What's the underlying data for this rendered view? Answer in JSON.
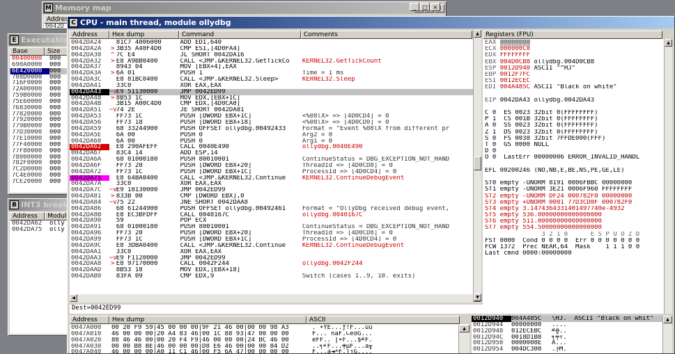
{
  "background_windows": {
    "memory_map": {
      "title": "Memory map",
      "icon": "M",
      "hdr": "Address",
      "row": "0042D"
    },
    "executable": {
      "title": "Executable modules",
      "icon": "E",
      "headers": [
        "Base",
        "Size"
      ],
      "rows": [
        {
          "base": "00400000",
          "size": "000",
          "red": true
        },
        {
          "base": "690A0000",
          "size": "000"
        },
        {
          "base": "6E420000",
          "size": "000",
          "sel": true
        },
        {
          "base": "708D0000",
          "size": "000"
        },
        {
          "base": "716F0000",
          "size": "000"
        },
        {
          "base": "72A00000",
          "size": "000"
        },
        {
          "base": "759B0000",
          "size": "000"
        },
        {
          "base": "75E60000",
          "size": "000"
        },
        {
          "base": "76830000",
          "size": "000"
        },
        {
          "base": "77820000",
          "size": "000"
        },
        {
          "base": "77920000",
          "size": "000"
        },
        {
          "base": "779B0000",
          "size": "000"
        },
        {
          "base": "77D30000",
          "size": "000"
        },
        {
          "base": "77E10000",
          "size": "000"
        },
        {
          "base": "77F40000",
          "size": "000"
        },
        {
          "base": "77F80000",
          "size": "000"
        },
        {
          "base": "78000000",
          "size": "000"
        },
        {
          "base": "782F0000",
          "size": "000"
        },
        {
          "base": "7C2D0000",
          "size": "000"
        },
        {
          "base": "7C4E0000",
          "size": "000"
        },
        {
          "base": "7CE20000",
          "size": "000"
        }
      ]
    },
    "int3": {
      "title": "INT3 breakpoints",
      "icon": "B",
      "headers": [
        "Address",
        "Module"
      ],
      "rows": [
        {
          "addr": "0042DA62",
          "mod": "olly"
        },
        {
          "addr": "0042DA75",
          "mod": "olly"
        }
      ]
    }
  },
  "cpu": {
    "title": "CPU - main thread, module ollydbg",
    "icon": "C",
    "win_buttons": [
      "_",
      "□",
      "×"
    ],
    "headers": {
      "addr": "Address",
      "hex": "Hex dump",
      "cmd": "Command",
      "com": "Comments",
      "regs": "Registers (FPU)"
    },
    "disasm": [
      {
        "a": "0042DA24",
        "m": "",
        "h": "81C7 4006000",
        "c": "ADD EDI,640",
        "k": ""
      },
      {
        "a": "0042DA2A",
        "m": ">",
        "h": "3B35 A40F4D0",
        "c": "CMP ESI,[4D0FA4]",
        "k": ""
      },
      {
        "a": "0042DA30",
        "m": "^",
        "h": "7C E4",
        "c": "JL SHORT 0042DA16",
        "k": ""
      },
      {
        "a": "0042DA32",
        "m": ">",
        "h": "E8 A9BB0400",
        "c": "CALL <JMP.&KERNEL32.GetTickCo",
        "k": "KERNEL32.GetTickCount",
        "kr": true
      },
      {
        "a": "0042DA37",
        "m": "",
        "h": "8943 04",
        "c": "MOV [EBX+4],EAX",
        "k": ""
      },
      {
        "a": "0042DA3A",
        "m": ">",
        "h": "6A 01",
        "c": "PUSH 1",
        "k": "Time = 1 ms"
      },
      {
        "a": "0042DA3C",
        "m": "",
        "h": "E8 81BC0400",
        "c": "CALL <JMP.&KERNEL32.Sleep>",
        "k": "KERNEL32.Sleep",
        "kr": true
      },
      {
        "a": "0042DA41",
        "m": "",
        "h": "33C0",
        "c": "XOR EAX,EAX",
        "k": ""
      },
      {
        "a": "0042DA43",
        "m": "~v",
        "h": "E9 51130000",
        "c": "JMP 0042ED99",
        "k": "",
        "sel": true
      },
      {
        "a": "0042DA48",
        "m": ">",
        "h": "8B53 1C",
        "c": "MOV EDX,[EBX+1C]",
        "k": ""
      },
      {
        "a": "0042DA4B",
        "m": "",
        "h": "3B15 A00C4D0",
        "c": "CMP EDX,[4D0CA0]",
        "k": ""
      },
      {
        "a": "0042DA51",
        "m": "~v",
        "h": "74 2E",
        "c": "JE SHORT 0042DA81",
        "k": ""
      },
      {
        "a": "0042DA53",
        "m": "",
        "h": "FF73 1C",
        "c": "PUSH [DWORD EBX+1C]",
        "k": "<%08lX> => [4D0CD4] = 0"
      },
      {
        "a": "0042DA56",
        "m": "",
        "h": "FF73 18",
        "c": "PUSH [DWORD EBX+18]",
        "k": "<%08lX> => [4D0CD0] = 0"
      },
      {
        "a": "0042DA59",
        "m": "",
        "h": "68 33244900",
        "c": "PUSH OFFSET ollydbg.00492433",
        "k": "Format = \"Event %08lX from different pr"
      },
      {
        "a": "0042DA5E",
        "m": "",
        "h": "6A 00",
        "c": "PUSH 0",
        "k": "Arg2 = 0"
      },
      {
        "a": "0042DA60",
        "m": "",
        "h": "6A 00",
        "c": "PUSH 0",
        "k": "Arg1 = 0"
      },
      {
        "a": "0042DA62",
        "m": "",
        "h": "E8 290AFEFF",
        "c": "CALL 0040E490",
        "k": "ollydbg.0040E490",
        "kr": true,
        "ac": "red"
      },
      {
        "a": "0042DA67",
        "m": "",
        "h": "83C4 14",
        "c": "ADD ESP,14",
        "k": ""
      },
      {
        "a": "0042DA6A",
        "m": "",
        "h": "68 01000180",
        "c": "PUSH 80010001",
        "k": "ContinueStatus = DBG_EXCEPTION_NOT_HAND"
      },
      {
        "a": "0042DA6F",
        "m": "",
        "h": "FF73 20",
        "c": "PUSH [DWORD EBX+20]",
        "k": "ThreadId => [4D0CD8] = 0"
      },
      {
        "a": "0042DA72",
        "m": "",
        "h": "FF73 1C",
        "c": "PUSH [DWORD EBX+1C]",
        "k": "ProcessId => [4D0CD4] = 0"
      },
      {
        "a": "0042DA75",
        "m": "",
        "h": "E8 64BA0400",
        "c": "CALL <JMP.&KERNEL32.Continue",
        "k": "KERNEL32.ContinueDebugEvent",
        "kr": true,
        "ac": "mag"
      },
      {
        "a": "0042DA7A",
        "m": "",
        "h": "33C0",
        "c": "XOR EAX,EAX",
        "k": ""
      },
      {
        "a": "0042DA7C",
        "m": "~v",
        "h": "E9 18130000",
        "c": "JMP 0042ED99",
        "k": ""
      },
      {
        "a": "0042DA81",
        "m": ">",
        "h": "833B 00",
        "c": "CMP [DWORD EBX],0",
        "k": ""
      },
      {
        "a": "0042DA84",
        "m": "~v",
        "h": "75 22",
        "c": "JNE SHORT 0042DAA8",
        "k": ""
      },
      {
        "a": "0042DA86",
        "m": "",
        "h": "68 61244900",
        "c": "PUSH OFFSET ollydbg.00492461",
        "k": "Format = \"OllyDbg received debug event,"
      },
      {
        "a": "0042DA8B",
        "m": "",
        "h": "E8 EC3BFDFF",
        "c": "CALL 0040167C",
        "k": "ollydbg.0040167C",
        "kr": true
      },
      {
        "a": "0042DA90",
        "m": "",
        "h": "59",
        "c": "POP ECX",
        "k": ""
      },
      {
        "a": "0042DA91",
        "m": "",
        "h": "68 01000180",
        "c": "PUSH 80010001",
        "k": "ContinueStatus = DBG_EXCEPTION_NOT_HAND"
      },
      {
        "a": "0042DA96",
        "m": "",
        "h": "FF73 20",
        "c": "PUSH [DWORD EBX+20]",
        "k": "ThreadId => [4D0CD8] = 0"
      },
      {
        "a": "0042DA99",
        "m": "",
        "h": "FF73 1C",
        "c": "PUSH [DWORD EBX+1C]",
        "k": "ProcessId => [4D0CD4] = 0"
      },
      {
        "a": "0042DA9C",
        "m": "",
        "h": "E8 3DBA0400",
        "c": "CALL <JMP.&KERNEL32.Continue",
        "k": "KERNEL32.ContinueDebugEvent",
        "kr": true
      },
      {
        "a": "0042DAA1",
        "m": "",
        "h": "33C0",
        "c": "XOR EAX,EAX",
        "k": ""
      },
      {
        "a": "0042DAA3",
        "m": "~v",
        "h": "E9 F1120000",
        "c": "JMP 0042ED99",
        "k": ""
      },
      {
        "a": "0042DAA8",
        "m": ">",
        "h": "E8 97170000",
        "c": "CALL 0042F244",
        "k": "ollydbg.0042F244",
        "kr": true
      },
      {
        "a": "0042DAAD",
        "m": "",
        "h": "8B53 18",
        "c": "MOV EDX,[EBX+18]",
        "k": ""
      },
      {
        "a": "0042DAB0",
        "m": "",
        "h": "83FA 09",
        "c": "CMP EDX,9",
        "k": "Switch (cases 1..9, 10. exits)"
      }
    ],
    "info_line": "Dest=0042ED99",
    "registers": [
      {
        "n": "EAX",
        "v": "00000000",
        "t": "",
        "grey": true
      },
      {
        "n": "ECX",
        "v": "000000C0",
        "t": "",
        "red": true
      },
      {
        "n": "EDX",
        "v": "FFFFFFFF",
        "t": "",
        "red": true
      },
      {
        "n": "EBX",
        "v": "004D0CB8",
        "t": "ollydbg.004D0CB8",
        "red": true
      },
      {
        "n": "ESP",
        "v": "0012D940",
        "t": "ASCII \"^HJ\"",
        "red": true
      },
      {
        "n": "EBP",
        "v": "0012F7FC",
        "t": "",
        "red": true
      },
      {
        "n": "ESI",
        "v": "0012ECEC",
        "t": "",
        "red": true
      },
      {
        "n": "EDI",
        "v": "004A485C",
        "t": "ASCII \"Black on white\"",
        "red": true
      },
      {
        "n": "",
        "v": "",
        "t": ""
      },
      {
        "n": "EIP",
        "v": "0042DA43",
        "t": "ollydbg.0042DA43",
        "red": false
      }
    ],
    "flags": [
      "C 0  ES 0023 32bit 0(FFFFFFFF)",
      "P 1  CS 001B 32bit 0(FFFFFFFF)",
      "A 0  SS 0023 32bit 0(FFFFFFFF)",
      "Z 1  DS 0023 32bit 0(FFFFFFFF)",
      "S 0  FS 0038 32bit 7FFDE000(FFF)",
      "T 0  GS 0000 NULL",
      "D 0",
      "O 0  LastErr 00000006 ERROR_INVALID_HANDL"
    ],
    "efl": "EFL 00200246 (NO,NB,E,BE,NS,PE,GE,LE)",
    "fpu": [
      "ST0 empty -UNORM 8191 0006FBBC 00000000",
      "ST1 empty -UNORM 3E21 0006F960 FFFFFFFF",
      "ST2 empty -UNORM DF24 000782F0 00000000",
      "ST3 empty +UNORM 0001 77D3CD0F 000782F0",
      "ST4 empty 3.1474364331401497740e-4932",
      "ST5 empty 536.00000000000000000",
      "ST6 empty 511.00000000000000000",
      "ST7 empty 554.50000000000000000"
    ],
    "fpu_bits_hdr": "               3 2 1 0      E S P U O Z D",
    "fst": "FST 0000  Cond 0 0 0 0  Err 0 0 0 0 0 0 0",
    "fcw": "FCW 1372  Prec NEAR,64  Mask    1 1 1 0 0",
    "last_cmnd": "Last cmnd 0000:00000000",
    "dump_headers": {
      "addr": "Address",
      "hex": "Hex dump",
      "ascii": "ASCII"
    },
    "dump": [
      {
        "a": "0047A000",
        "h": "00 20 F9 59|45 00 00 00|9F 21 46 00|00 00 98 A3",
        "s": ". ∙YE...ƒ!F...ùú"
      },
      {
        "a": "0047A010",
        "h": "46 00 00 00|20 A4 83 46|00 1C 88 93|47 00 00 00",
        "s": "F... ñâF.∟êôG..."
      },
      {
        "a": "0047A020",
        "h": "88 46 46 00|00 20 F4 F9|46 00 00 00|24 BC 46 00",
        "s": "êFF.. ⌠∙F...$╝F."
      },
      {
        "a": "0047A030",
        "h": "00 00 B8 BE|46 00 00 00|D8 E6 46 00|00 00 84 D2",
        "s": "..╕╛F...╪µF...ä╥"
      },
      {
        "a": "0047A040",
        "h": "46 00 00 00|A0 11 C1 46|00 F5 6A 47|00 00 00 00",
        "s": "F...á◄┴F.⌡jG...."
      }
    ],
    "stack": [
      {
        "a": "0012D940",
        "v": "004A485C",
        "t": "\\HJ.  ASCII \"Black on whit\""
      },
      {
        "a": "0012D944",
        "v": "00000000",
        "t": "...."
      },
      {
        "a": "0012D948",
        "v": "012ECEBC",
        "t": "╝╬.."
      },
      {
        "a": "0012D94C",
        "v": "0018D1B8",
        "t": "╕╤↑."
      },
      {
        "a": "0012D950",
        "v": "0000008E",
        "t": "Ä..."
      },
      {
        "a": "0012D954",
        "v": "004DC300",
        "t": ".├M."
      }
    ]
  }
}
